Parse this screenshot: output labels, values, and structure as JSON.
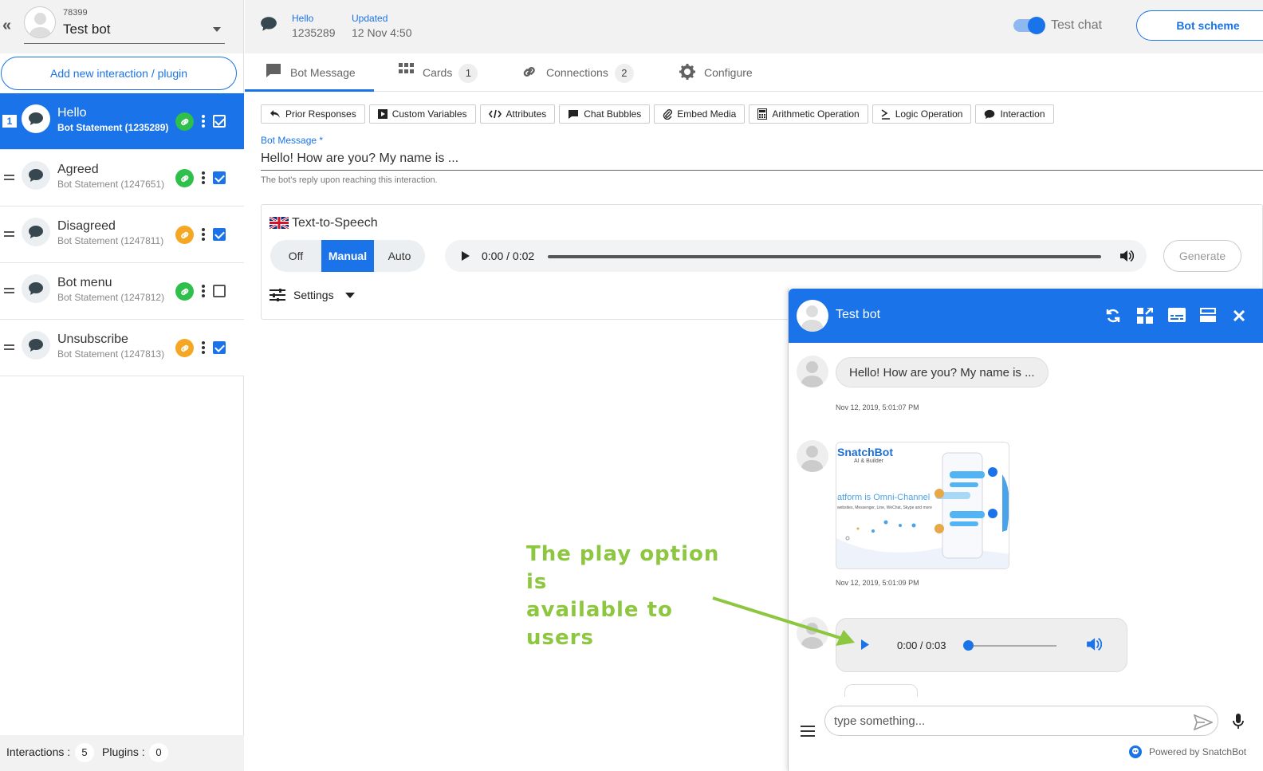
{
  "bot": {
    "id": "78399",
    "name": "Test bot"
  },
  "sidebar": {
    "add_label": "Add new interaction / plugin",
    "items": [
      {
        "number": "1",
        "title": "Hello",
        "subtitle": "Bot Statement (1235289)",
        "link_color": "green",
        "checked": true,
        "active": true
      },
      {
        "title": "Agreed",
        "subtitle": "Bot Statement (1247651)",
        "link_color": "green",
        "checked": true
      },
      {
        "title": "Disagreed",
        "subtitle": "Bot Statement (1247811)",
        "link_color": "orange",
        "checked": true
      },
      {
        "title": "Bot menu",
        "subtitle": "Bot Statement (1247812)",
        "link_color": "green",
        "checked": false
      },
      {
        "title": "Unsubscribe",
        "subtitle": "Bot Statement (1247813)",
        "link_color": "orange",
        "checked": true
      }
    ],
    "footer": {
      "interactions_label": "Interactions :",
      "interactions_count": "5",
      "plugins_label": "Plugins :",
      "plugins_count": "0"
    }
  },
  "header": {
    "name_label": "Hello",
    "name_value": "1235289",
    "updated_label": "Updated",
    "updated_value": "12 Nov 4:50",
    "test_chat_label": "Test chat",
    "test_chat_on": true,
    "bot_scheme_label": "Bot scheme"
  },
  "tabs": [
    {
      "label": "Bot Message",
      "icon": "message-icon",
      "active": true
    },
    {
      "label": "Cards",
      "icon": "grid-icon",
      "count": "1"
    },
    {
      "label": "Connections",
      "icon": "link-icon",
      "count": "2"
    },
    {
      "label": "Configure",
      "icon": "gear-icon"
    }
  ],
  "toolbar": [
    {
      "label": "Prior Responses",
      "icon": "reply-icon"
    },
    {
      "label": "Custom Variables",
      "icon": "play-square-icon"
    },
    {
      "label": "Attributes",
      "icon": "code-icon"
    },
    {
      "label": "Chat Bubbles",
      "icon": "chat-bubble-icon"
    },
    {
      "label": "Embed Media",
      "icon": "paperclip-icon"
    },
    {
      "label": "Arithmetic Operation",
      "icon": "calculator-icon"
    },
    {
      "label": "Logic Operation",
      "icon": "sigma-icon"
    },
    {
      "label": "Interaction",
      "icon": "comment-icon"
    }
  ],
  "bot_message": {
    "label": "Bot Message *",
    "value": "Hello! How are you? My name is ...",
    "helper": "The bot's reply upon reaching this interaction."
  },
  "tts": {
    "title": "Text-to-Speech",
    "modes": [
      "Off",
      "Manual",
      "Auto"
    ],
    "selected_mode": "Manual",
    "player_time": "0:00 / 0:02",
    "generate_label": "Generate",
    "settings_label": "Settings"
  },
  "chat": {
    "title": "Test bot",
    "messages": [
      {
        "type": "text",
        "text": "Hello! How are you? My name is ...",
        "time": "Nov 12, 2019, 5:01:07 PM"
      },
      {
        "type": "image",
        "brand": "SnatchBot",
        "tagline": "AI & Builder",
        "headline": "atform is Omni-Channel",
        "caption": "websites, Messenger, Line, WeChat, Skype and more",
        "time": "Nov 12, 2019, 5:01:09 PM"
      },
      {
        "type": "audio",
        "time_text": "0:00 / 0:03"
      }
    ],
    "input_placeholder": "type something...",
    "powered_by": "Powered by SnatchBot"
  },
  "annotation": {
    "line1": "The play option is",
    "line2": "available to users",
    "color": "#8dc63f"
  },
  "colors": {
    "accent": "#1a73e8",
    "link_green": "#2fbf4b",
    "link_orange": "#f5a623",
    "annotation": "#8dc63f"
  }
}
